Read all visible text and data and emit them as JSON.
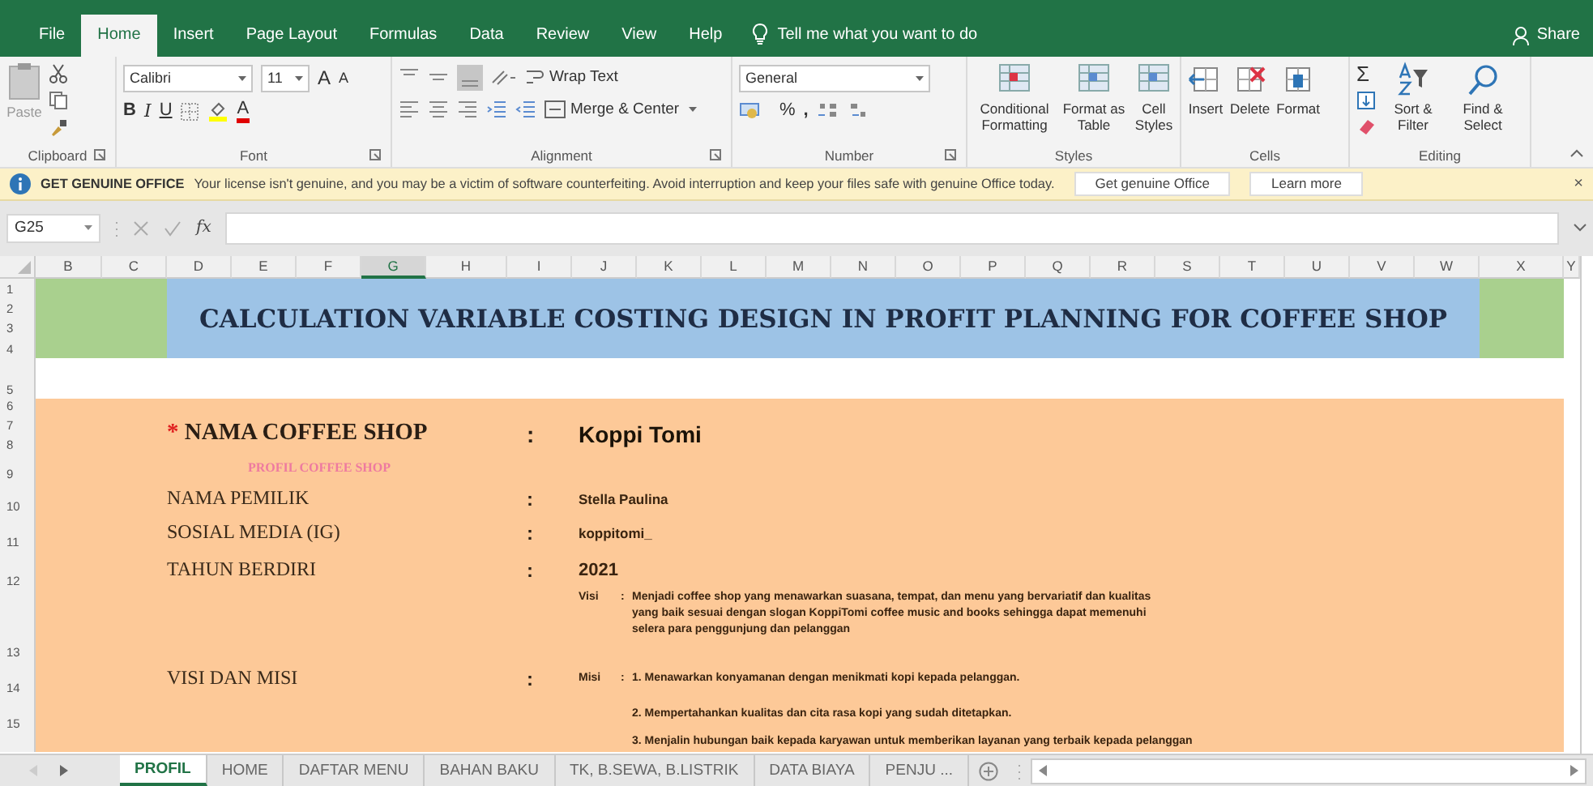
{
  "ribbon_tabs": [
    {
      "label": "File",
      "selected": false
    },
    {
      "label": "Home",
      "selected": true
    },
    {
      "label": "Insert",
      "selected": false
    },
    {
      "label": "Page Layout",
      "selected": false
    },
    {
      "label": "Formulas",
      "selected": false
    },
    {
      "label": "Data",
      "selected": false
    },
    {
      "label": "Review",
      "selected": false
    },
    {
      "label": "View",
      "selected": false
    },
    {
      "label": "Help",
      "selected": false
    }
  ],
  "tell_me": "Tell me what you want to do",
  "share": "Share",
  "ribbon": {
    "clipboard": {
      "paste": "Paste",
      "group": "Clipboard"
    },
    "font": {
      "name": "Calibri",
      "size": "11",
      "grow": "A",
      "shrink": "A",
      "bold": "B",
      "italic": "I",
      "underline": "U",
      "font_color": "A",
      "group": "Font"
    },
    "alignment": {
      "wrap_text": "Wrap Text",
      "merge_center": "Merge & Center",
      "group": "Alignment"
    },
    "number": {
      "format": "General",
      "percent": "%",
      "comma": ",",
      "group": "Number"
    },
    "styles": {
      "buttons": [
        "Conditional Formatting",
        "Format as Table",
        "Cell Styles"
      ],
      "group": "Styles"
    },
    "cells": {
      "buttons": [
        "Insert",
        "Delete",
        "Format"
      ],
      "group": "Cells"
    },
    "editing": {
      "sum": "Σ",
      "buttons": [
        "Sort & Filter",
        "Find & Select"
      ],
      "group": "Editing"
    }
  },
  "message_bar": {
    "title": "GET GENUINE OFFICE",
    "text": "Your license isn't genuine, and you may be a victim of software counterfeiting. Avoid interruption and keep your files safe with genuine Office today.",
    "buttons": [
      "Get genuine Office",
      "Learn more"
    ],
    "close": "×"
  },
  "formula_bar": {
    "name_box": "G25",
    "fx": "fx"
  },
  "columns": [
    {
      "label": "B",
      "selected": false
    },
    {
      "label": "C",
      "selected": false
    },
    {
      "label": "D",
      "selected": false
    },
    {
      "label": "E",
      "selected": false
    },
    {
      "label": "F",
      "selected": false
    },
    {
      "label": "G",
      "selected": true
    },
    {
      "label": "H",
      "selected": false
    },
    {
      "label": "I",
      "selected": false
    },
    {
      "label": "J",
      "selected": false
    },
    {
      "label": "K",
      "selected": false
    },
    {
      "label": "L",
      "selected": false
    },
    {
      "label": "M",
      "selected": false
    },
    {
      "label": "N",
      "selected": false
    },
    {
      "label": "O",
      "selected": false
    },
    {
      "label": "P",
      "selected": false
    },
    {
      "label": "Q",
      "selected": false
    },
    {
      "label": "R",
      "selected": false
    },
    {
      "label": "S",
      "selected": false
    },
    {
      "label": "T",
      "selected": false
    },
    {
      "label": "U",
      "selected": false
    },
    {
      "label": "V",
      "selected": false
    },
    {
      "label": "W",
      "selected": false
    },
    {
      "label": "X",
      "selected": false
    },
    {
      "label": "Y",
      "selected": false
    }
  ],
  "rows": [
    "1",
    "2",
    "3",
    "4",
    "5",
    "6",
    "7",
    "8",
    "9",
    "10",
    "11",
    "12",
    "13",
    "14",
    "15"
  ],
  "title": "CALCULATION VARIABLE COSTING DESIGN IN PROFIT PLANNING FOR COFFEE SHOP",
  "profile": {
    "shop": {
      "mark": "*",
      "label": "NAMA COFFEE SHOP",
      "colon": ":",
      "value": "Koppi Tomi"
    },
    "subtitle": "PROFIL COFFEE SHOP",
    "fields": [
      {
        "label": "NAMA PEMILIK",
        "colon": ":",
        "value": "Stella Paulina"
      },
      {
        "label": "SOSIAL MEDIA (IG)",
        "colon": ":",
        "value": "koppitomi_"
      },
      {
        "label": "TAHUN BERDIRI",
        "colon": ":",
        "value": "2021"
      }
    ],
    "vision_mission": {
      "label": "VISI DAN MISI",
      "colon": ":",
      "visi": {
        "label": "Visi",
        "separator": ":",
        "text": "Menjadi coffee shop yang menawarkan suasana, tempat, dan menu yang bervariatif dan kualitas yang baik sesuai dengan slogan KoppiTomi coffee music and books sehingga dapat memenuhi selera para penggunjung dan pelanggan"
      },
      "misi": {
        "label": "Misi",
        "separator": ":",
        "items": [
          "1. Menawarkan konyamanan dengan menikmati kopi kepada pelanggan.",
          "2. Mempertahankan kualitas dan cita rasa kopi yang sudah ditetapkan.",
          "3. Menjalin hubungan baik kepada karyawan untuk memberikan layanan yang terbaik kepada pelanggan"
        ]
      }
    }
  },
  "sheet_tabs": [
    {
      "label": "PROFIL",
      "selected": true
    },
    {
      "label": "HOME",
      "selected": false
    },
    {
      "label": "DAFTAR MENU",
      "selected": false
    },
    {
      "label": "BAHAN BAKU",
      "selected": false
    },
    {
      "label": "TK, B.SEWA, B.LISTRIK",
      "selected": false
    },
    {
      "label": "DATA BIAYA",
      "selected": false
    },
    {
      "label": "PENJU ...",
      "selected": false
    }
  ]
}
